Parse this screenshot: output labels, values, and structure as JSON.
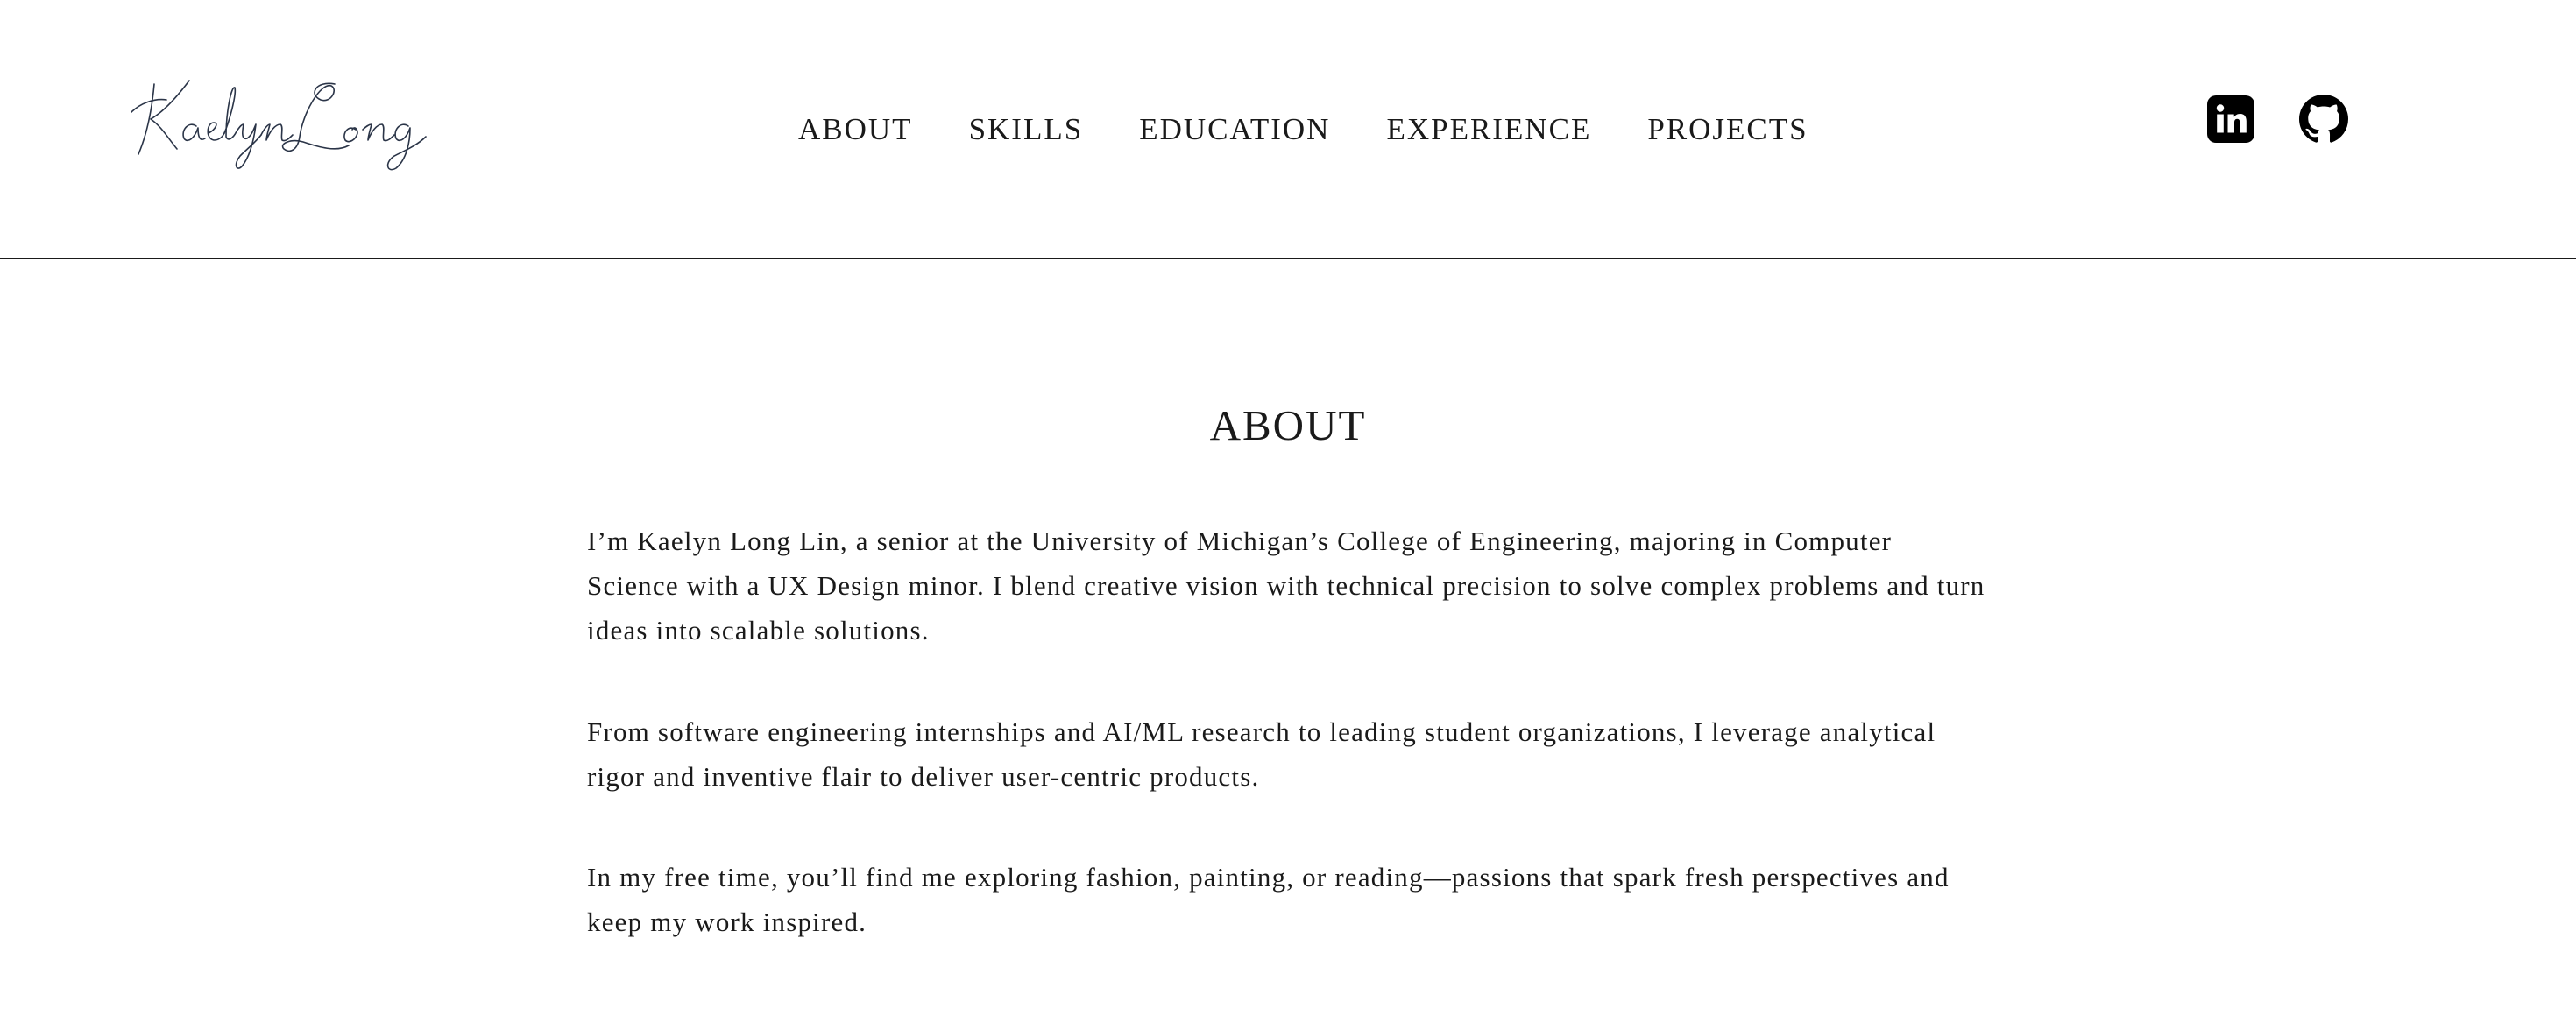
{
  "header": {
    "logo_text": "Kaelyn Long",
    "nav": [
      {
        "label": "ABOUT"
      },
      {
        "label": "SKILLS"
      },
      {
        "label": "EDUCATION"
      },
      {
        "label": "EXPERIENCE"
      },
      {
        "label": "PROJECTS"
      }
    ],
    "social": [
      {
        "icon": "linkedin-icon"
      },
      {
        "icon": "github-icon"
      }
    ]
  },
  "about": {
    "title": "ABOUT",
    "paragraphs": [
      "I’m Kaelyn Long Lin, a senior at the University of Michigan’s College of Engineering, majoring in Computer Science with a UX Design minor. I blend creative vision with technical precision to solve complex problems and turn ideas into scalable solutions.",
      "From software engineering internships and AI/ML research to leading student organizations, I leverage analytical rigor and inventive flair to deliver user-centric products.",
      "In my free time, you’ll find me exploring fashion, painting, or reading—passions that spark fresh perspectives and keep my work inspired."
    ]
  },
  "colors": {
    "text": "#1a1a1a",
    "logo": "#2b3548",
    "background": "#ffffff",
    "divider": "#1a1a1a"
  }
}
